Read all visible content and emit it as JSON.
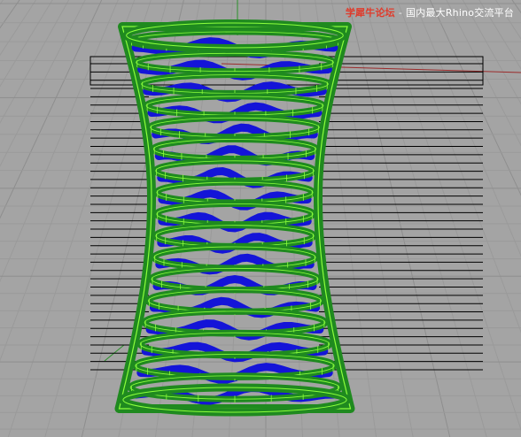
{
  "viewport": {
    "name": "perspective-viewport",
    "background_color": "#a4a4a4",
    "grid_color": "#9a9a9a",
    "grid_major_color": "#8e8e8e"
  },
  "watermark": {
    "site": "学犀牛论坛",
    "separator": "-",
    "tagline": "国内最大Rhino交流平台"
  },
  "model": {
    "description_colors": {
      "outer_bands": "#1f8a1f",
      "outer_band_edge": "#8cff3c",
      "inner_bands": "#1414d8",
      "contour_lines": "#000000"
    },
    "contour_line_count": 38,
    "band_pair_count": 17
  },
  "axes": {
    "x_axis_color": "#9b2b2b",
    "y_axis_color": "#2b8f2b"
  }
}
